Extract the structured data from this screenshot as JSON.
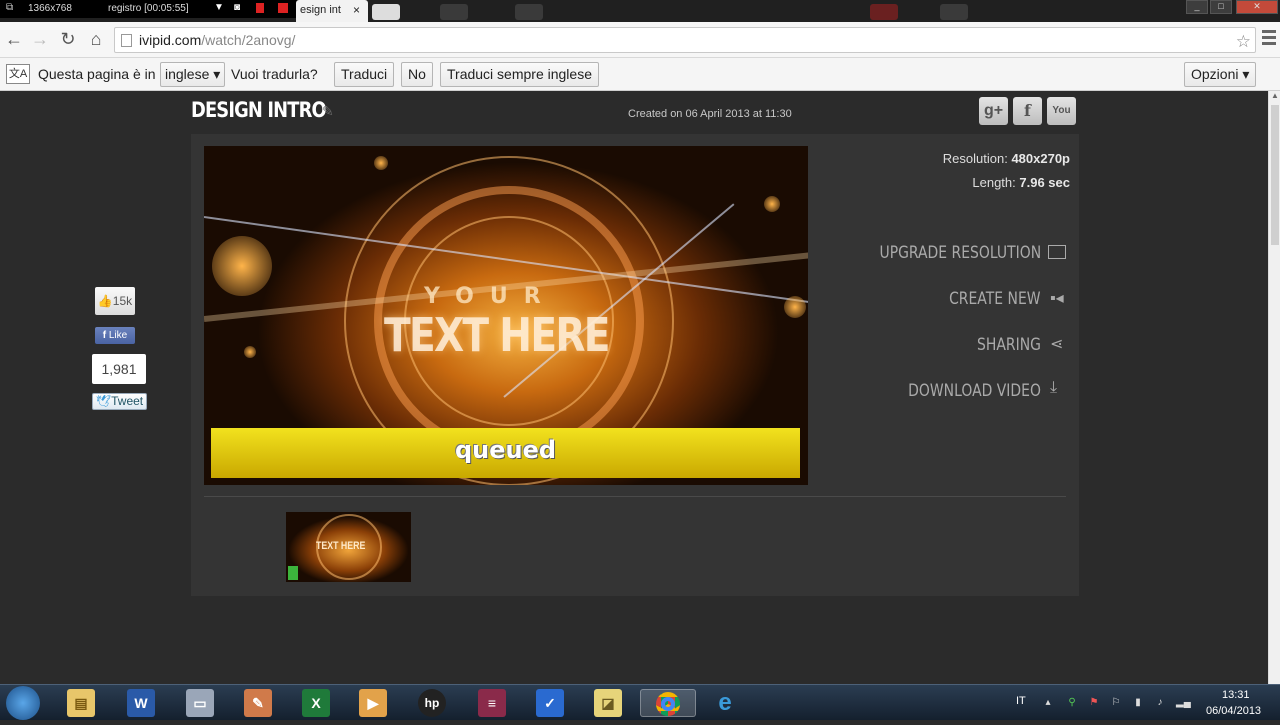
{
  "recorder": {
    "resolution": "1366x768",
    "status": "registro [00:05:55]"
  },
  "tab": {
    "title": "esign int",
    "close": "×"
  },
  "address": {
    "domain": "ivipid.com",
    "path": "/watch/2anovg/"
  },
  "translate": {
    "prefix": "Questa pagina è in",
    "language": "inglese ▾",
    "question": "Vuoi tradurla?",
    "translate_btn": "Traduci",
    "no_btn": "No",
    "always_btn": "Traduci sempre inglese",
    "options_btn": "Opzioni ▾"
  },
  "video": {
    "title": "DESIGN INTRO",
    "created": "Created on 06 April 2013 at 11:30",
    "resolution_label": "Resolution:",
    "resolution_value": "480x270p",
    "length_label": "Length:",
    "length_value": "7.96 sec",
    "preview_line1": "YOUR",
    "preview_line2": "TEXT HERE",
    "status": "queued",
    "thumb_text": "TEXT HERE"
  },
  "social": {
    "gplus": "g+",
    "facebook": "f",
    "youtube": "You"
  },
  "actions": {
    "upgrade": "UPGRADE RESOLUTION",
    "create": "CREATE NEW",
    "sharing": "SHARING",
    "download": "DOWNLOAD VIDEO"
  },
  "share_widget": {
    "likes": "15k",
    "fb_like": "Like",
    "count": "1,981",
    "tweet": "Tweet"
  },
  "taskbar": {
    "lang": "IT",
    "time": "13:31",
    "date": "06/04/2013"
  },
  "colors": {
    "queued_bar": "#e6d214",
    "page_bg": "#2b2b2b",
    "card_bg": "#343434"
  }
}
